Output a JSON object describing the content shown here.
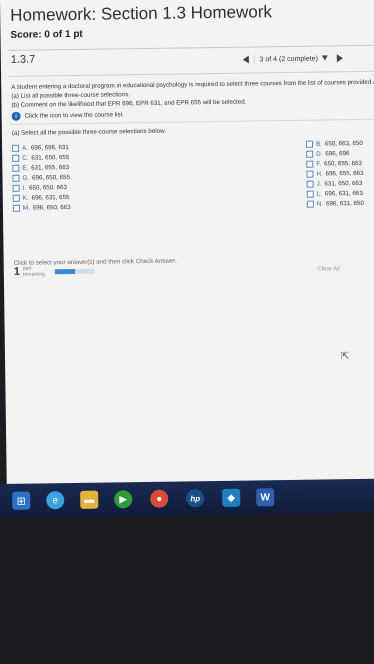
{
  "header": {
    "title": "Homework: Section 1.3 Homework",
    "score_label": "Score:",
    "score_value": "0 of 1 pt"
  },
  "question": {
    "number": "1.3.7",
    "nav_status": "3 of 4 (2 complete)"
  },
  "problem": {
    "intro": "A student entering a doctoral program in educational psychology is required to select three courses from the list of courses provided as part of his or her program.",
    "part_a_prompt": "(a) List all possible three-course selections.",
    "part_b_prompt": "(b) Comment on the likelihood that EPR 696, EPR 631, and EPR 655 will be selected.",
    "info_text": "Click the icon to view the course list.",
    "part_a_instruction": "(a) Select all the possible three-course selections below."
  },
  "options_left": [
    {
      "letter": "A.",
      "value": "696, 696, 631"
    },
    {
      "letter": "C.",
      "value": "631, 650, 655"
    },
    {
      "letter": "E.",
      "value": "631, 655, 663"
    },
    {
      "letter": "G.",
      "value": "696, 650, 655"
    },
    {
      "letter": "I.",
      "value": "650, 650, 663"
    },
    {
      "letter": "K.",
      "value": "696, 631, 655"
    },
    {
      "letter": "M.",
      "value": "696, 650, 663"
    }
  ],
  "options_right": [
    {
      "letter": "B.",
      "value": "650, 663, 650"
    },
    {
      "letter": "D.",
      "value": "696, 696"
    },
    {
      "letter": "F.",
      "value": "650, 655, 663"
    },
    {
      "letter": "H.",
      "value": "696, 655, 663"
    },
    {
      "letter": "J.",
      "value": "631, 650, 663"
    },
    {
      "letter": "L.",
      "value": "696, 631, 663"
    },
    {
      "letter": "N.",
      "value": "696, 631, 650"
    }
  ],
  "footer": {
    "note": "Click to select your answer(s) and then click Check Answer.",
    "clear_all": "Clear All",
    "part_number": "1",
    "part_label_1": "part",
    "part_label_2": "remaining",
    "progress_fraction": 0.5
  },
  "taskbar": {
    "icons": [
      "start-icon",
      "internet-explorer-icon",
      "folder-icon",
      "media-player-icon",
      "chrome-icon",
      "hp-icon",
      "app-icon",
      "word-icon"
    ],
    "hp_text": "hp",
    "word_text": "W"
  },
  "colors": {
    "accent": "#1f63b6",
    "option_letter": "#2b5fa8",
    "progress": "#3b8bd4"
  }
}
